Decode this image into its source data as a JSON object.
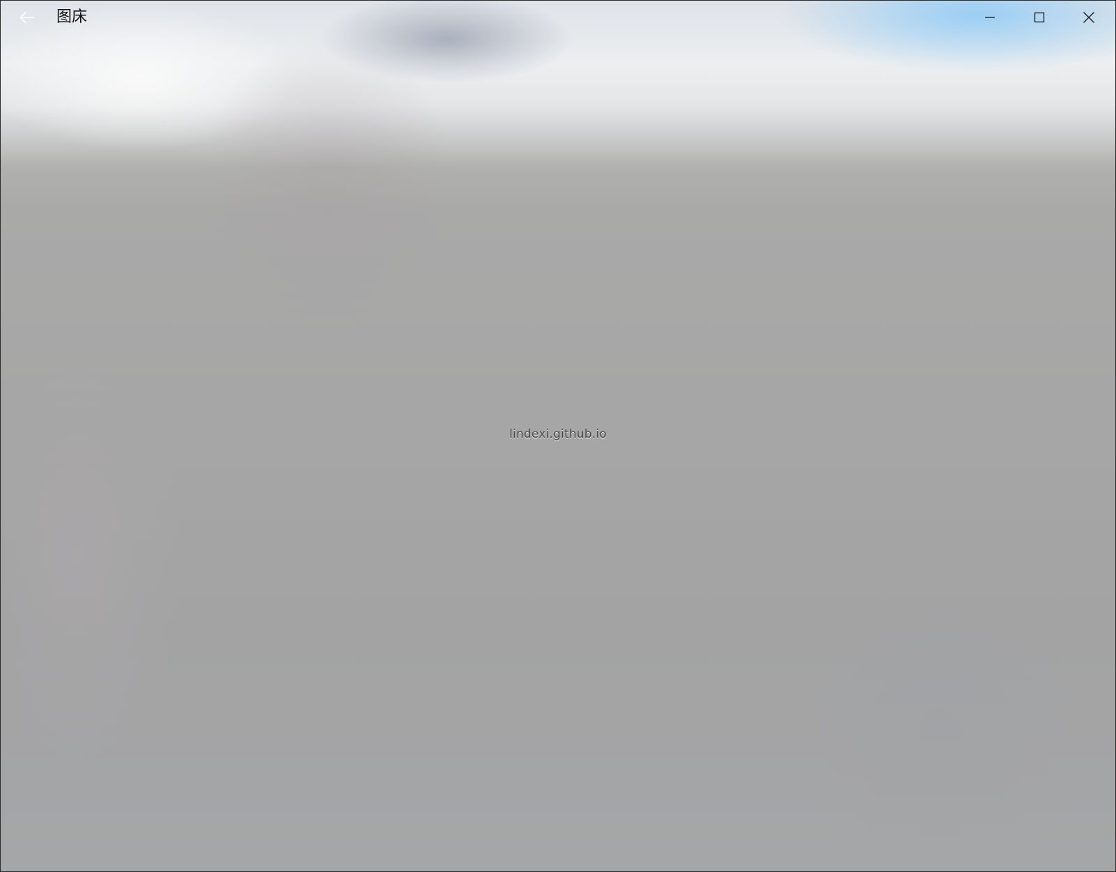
{
  "window": {
    "title": "图床"
  },
  "icons": {
    "back": "back-arrow-icon",
    "minimize": "minimize-icon",
    "maximize": "maximize-icon",
    "close": "close-icon"
  },
  "main": {
    "center_text": "lindexi.github.io"
  }
}
